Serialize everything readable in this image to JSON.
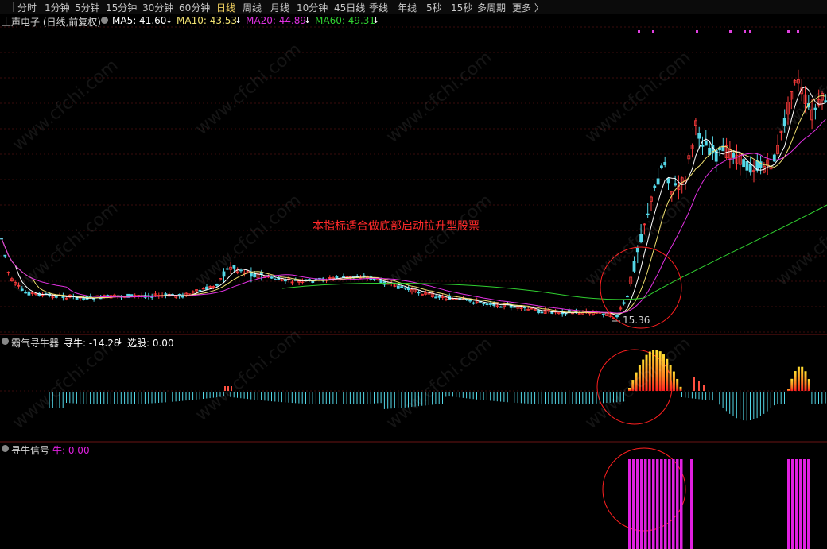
{
  "toolbar": {
    "items": [
      "分时",
      "1分钟",
      "5分钟",
      "15分钟",
      "30分钟",
      "60分钟",
      "日线",
      "周线",
      "月线",
      "10分钟",
      "45日线",
      "季线",
      "年线",
      "5秒",
      "15秒",
      "多周期",
      "更多 〉"
    ],
    "active": "日线"
  },
  "main_legend": {
    "title": "上声电子 (日线,前复权)",
    "ma5": "MA5: 41.60",
    "ma10": "MA10: 43.53",
    "ma20": "MA20: 44.89",
    "ma60": "MA60: 49.31",
    "down_arrow": "↓"
  },
  "annotation": "本指标适合做底部启动拉升型股票",
  "low_label": "15.36",
  "ind1_legend": {
    "name": "霸气寻牛器",
    "val1": "寻牛: -14.28",
    "val2": "选股: 0.00"
  },
  "ind2_legend": {
    "name": "寻牛信号",
    "val1": "牛: 0.00"
  },
  "watermark": "www.cfchi.com",
  "colors": {
    "up": "#ff3b3b",
    "down": "#54d8e8",
    "ma5": "#ffffff",
    "ma10": "#f0e070",
    "ma20": "#e030e0",
    "ma60": "#30d030",
    "signal": "#e020e0",
    "circle": "#ff2020"
  },
  "chart_data": {
    "type": "candlestick",
    "series_names": [
      "MA5",
      "MA10",
      "MA20",
      "MA60"
    ],
    "low_price": 15.36,
    "panels": [
      "price",
      "寻牛",
      "寻牛信号"
    ]
  }
}
